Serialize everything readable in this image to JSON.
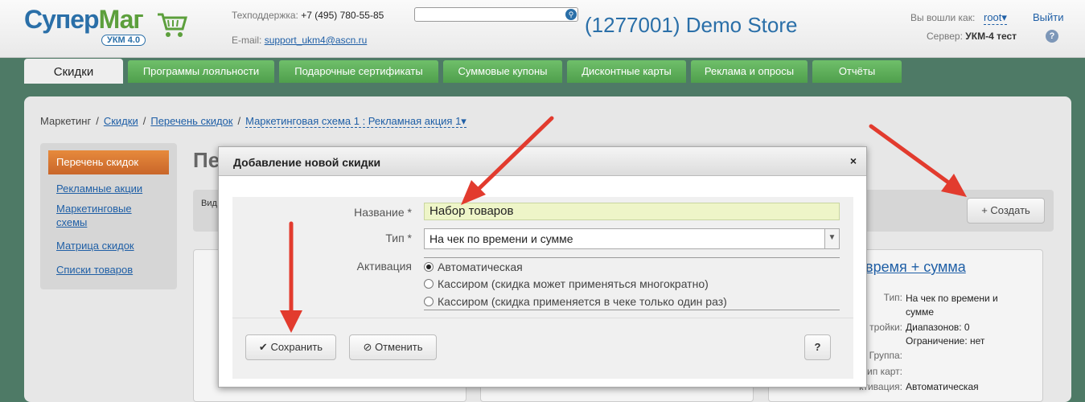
{
  "header": {
    "logo_main": "Супер",
    "logo_accent": "Маг",
    "logo_sub": "УКМ 4.0",
    "support_label": "Техподдержка:",
    "support_phone": "+7 (495) 780-55-85",
    "email_label": "E-mail:",
    "email": "support_ukm4@ascn.ru",
    "search_placeholder": "",
    "store_title": "(1277001) Demo Store",
    "login_label": "Вы вошли как:",
    "login_user": "root",
    "logout": "Выйти",
    "server_label": "Сервер:",
    "server_value": "УКМ-4 тест",
    "help": "?"
  },
  "tabs": [
    {
      "label": "Скидки"
    },
    {
      "label": "Программы лояльности"
    },
    {
      "label": "Подарочные сертификаты"
    },
    {
      "label": "Суммовые купоны"
    },
    {
      "label": "Дисконтные карты"
    },
    {
      "label": "Реклама и опросы"
    },
    {
      "label": "Отчёты"
    }
  ],
  "breadcrumb": {
    "root": "Маркетинг",
    "items": [
      "Скидки",
      "Перечень скидок"
    ],
    "current": "Маркетинговая схема 1 : Рекламная акция 1",
    "sep": "/"
  },
  "sidebar": {
    "active": "Перечень скидок",
    "links": [
      "Рекламные акции",
      "Маркетинговые схемы",
      "Матрица скидок",
      "Списки товаров"
    ]
  },
  "page": {
    "title": "Пер",
    "toolbar_label": "Вид",
    "create_label": "Создать"
  },
  "card": {
    "title": "время + сумма",
    "rows": [
      {
        "key": "Тип:",
        "value": "На чек по времени и сумме"
      },
      {
        "key": "тройки:",
        "value": "Диапазонов: 0"
      },
      {
        "key": "",
        "value": "Ограничение: нет"
      },
      {
        "key": "Группа:",
        "value": ""
      },
      {
        "key": "ип карт:",
        "value": ""
      },
      {
        "key": "ктивация:",
        "value": "Автоматическая"
      }
    ]
  },
  "modal": {
    "title": "Добавление новой скидки",
    "close": "×",
    "name_label": "Название *",
    "name_value": "Набор товаров",
    "type_label": "Тип *",
    "type_value": "На чек по времени и сумме",
    "activation_label": "Активация",
    "activation_options": [
      {
        "label": "Автоматическая",
        "checked": true
      },
      {
        "label": "Кассиром (скидка может применяться многократно)",
        "checked": false
      },
      {
        "label": "Кассиром (скидка применяется в чеке только один раз)",
        "checked": false
      }
    ],
    "save_label": "Сохранить",
    "cancel_label": "Отменить",
    "help_label": "?"
  },
  "colors": {
    "brand_blue": "#2a6fa8",
    "brand_green": "#5c9f3c",
    "tab_green": "#5aaa56",
    "background": "#4e7a66",
    "active_sidebar": "#d8763a",
    "arrow_red": "#e23b2e"
  }
}
